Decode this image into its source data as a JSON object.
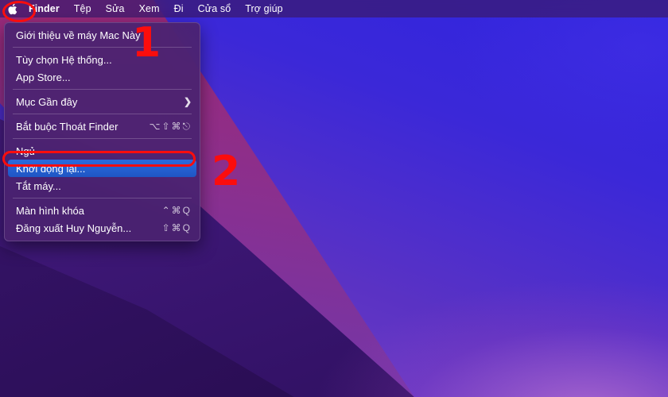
{
  "menubar": {
    "apple_icon": "apple-logo-icon",
    "items": [
      {
        "label": "Finder",
        "bold": true
      },
      {
        "label": "Tệp",
        "bold": false
      },
      {
        "label": "Sửa",
        "bold": false
      },
      {
        "label": "Xem",
        "bold": false
      },
      {
        "label": "Đi",
        "bold": false
      },
      {
        "label": "Cửa sổ",
        "bold": false
      },
      {
        "label": "Trợ giúp",
        "bold": false
      }
    ]
  },
  "apple_menu": {
    "groups": [
      {
        "items": [
          {
            "label": "Giới thiệu về máy Mac Này",
            "shortcut": "",
            "submenu": false,
            "selected": false
          }
        ]
      },
      {
        "items": [
          {
            "label": "Tùy chọn Hệ thống...",
            "shortcut": "",
            "submenu": false,
            "selected": false
          },
          {
            "label": "App Store...",
            "shortcut": "",
            "submenu": false,
            "selected": false
          }
        ]
      },
      {
        "items": [
          {
            "label": "Mục Gần đây",
            "shortcut": "",
            "submenu": true,
            "chevron": "❯",
            "selected": false
          }
        ]
      },
      {
        "items": [
          {
            "label": "Bắt buộc Thoát Finder",
            "shortcut": "⌥⇧⌘⎋",
            "submenu": false,
            "selected": false
          }
        ]
      },
      {
        "items": [
          {
            "label": "Ngủ",
            "shortcut": "",
            "submenu": false,
            "selected": false
          },
          {
            "label": "Khởi động lại...",
            "shortcut": "",
            "submenu": false,
            "selected": true
          },
          {
            "label": "Tắt máy...",
            "shortcut": "",
            "submenu": false,
            "selected": false
          }
        ]
      },
      {
        "items": [
          {
            "label": "Màn hình khóa",
            "shortcut": "⌃⌘Q",
            "submenu": false,
            "selected": false
          },
          {
            "label": "Đăng xuất Huy Nguyễn...",
            "shortcut": "⇧⌘Q",
            "submenu": false,
            "selected": false
          }
        ]
      }
    ]
  },
  "annotations": {
    "step_one": "1",
    "step_two": "2",
    "color": "#fb0d0d"
  },
  "colors": {
    "menu_background": "#4a2270",
    "highlight_blue": "#1f5fd0",
    "menubar_background": "#3a1a6e",
    "annotation_red": "#fb0d0d"
  }
}
